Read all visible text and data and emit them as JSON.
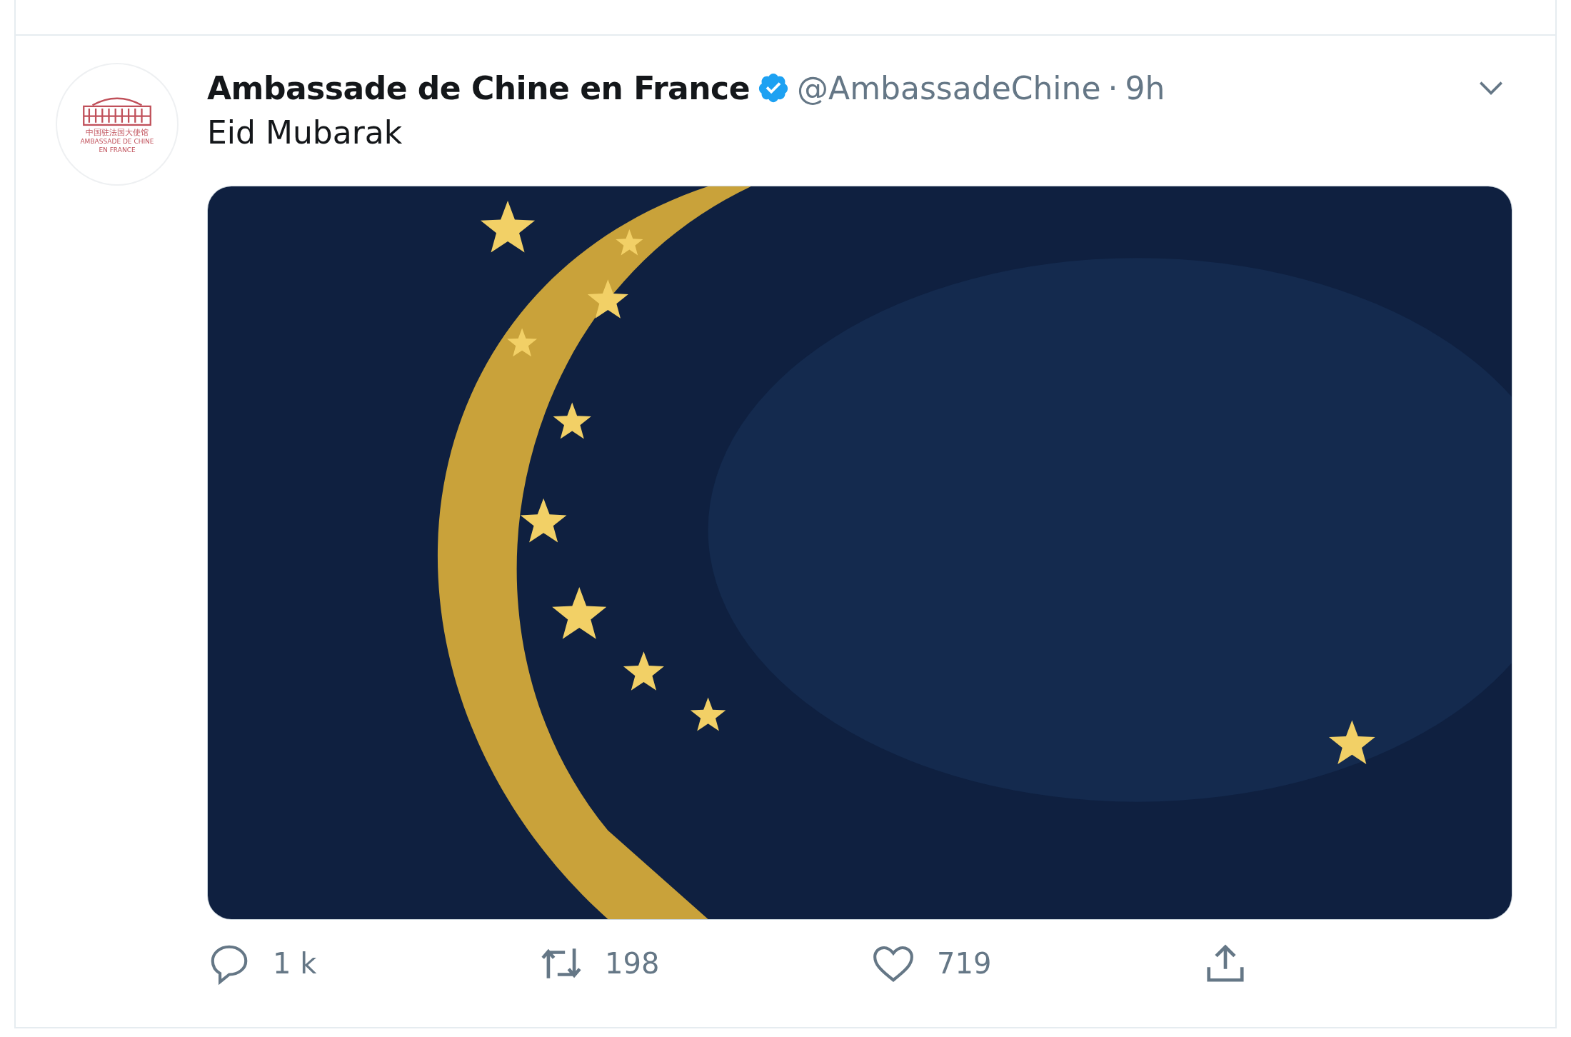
{
  "tweet": {
    "avatar": {
      "line_1": "中国驻法国大使馆",
      "line_2": "AMBASSADE DE CHINE",
      "line_3": "EN FRANCE"
    },
    "author": "Ambassade de Chine en France",
    "verified": true,
    "handle": "@AmbassadeChine",
    "separator": "·",
    "time": "9h",
    "text": "Eid Mubarak",
    "actions": [
      {
        "kind": "reply",
        "count": "1 k"
      },
      {
        "kind": "retweet",
        "count": "198"
      },
      {
        "kind": "like",
        "count": "719"
      },
      {
        "kind": "share"
      }
    ]
  }
}
